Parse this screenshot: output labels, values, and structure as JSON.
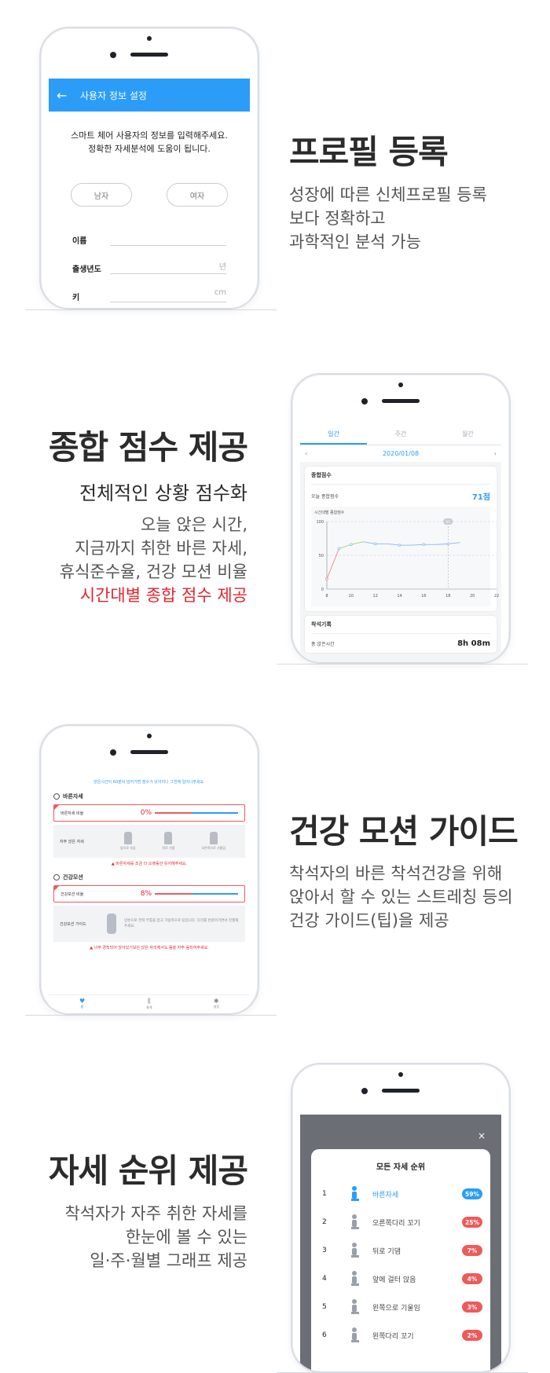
{
  "colors": {
    "accent": "#2b9df8",
    "red": "#e4252e",
    "badge_red": "#ee5a5a"
  },
  "section1": {
    "heading": "프로필 등록",
    "desc": [
      "성장에 따른 신체프로필 등록",
      "보다 정확하고",
      "과학적인 분석 가능"
    ],
    "screen": {
      "back_icon": "←",
      "title": "사용자 정보 설정",
      "intro": [
        "스마트 체어 사용자의 정보를 입력해주세요.",
        "정확한 자세분석에 도움이 됩니다."
      ],
      "gender_male": "남자",
      "gender_female": "여자",
      "fields": [
        {
          "label": "이름",
          "unit": ""
        },
        {
          "label": "출생년도",
          "unit": "년"
        },
        {
          "label": "키",
          "unit": "cm"
        }
      ]
    }
  },
  "section2": {
    "heading": "종합 점수 제공",
    "subhead": "전체적인 상황 점수화",
    "desc": [
      "오늘 앉은 시간,",
      "지금까지 취한 바른 자세,",
      "휴식준수율, 건강 모션 비율"
    ],
    "desc_highlight": "시간대별 종합 점수 제공",
    "screen": {
      "tabs": [
        "일간",
        "주간",
        "월간"
      ],
      "date": "2020/01/08",
      "prev": "‹",
      "next": "›",
      "card_title": "종합점수",
      "today_label": "오늘 종합점수",
      "today_score": "71점",
      "chart_title": "시간대별 종합점수",
      "card2_title": "착석기록",
      "sit_label": "총 앉은시간",
      "sit_value": "8h 08m"
    }
  },
  "section3": {
    "heading": "건강 모션 가이드",
    "desc": [
      "착석자의 바른 착석건강을 위해",
      "앉아서 할 수 있는 스트레칭 등의",
      "건강 가이드(팁)을 제공"
    ],
    "screen": {
      "hint": "앉은시간이 60분이 넘어가면 점수가 낮아지니 그전에 일어나주세요.",
      "sec1": "바른자세",
      "ratio1_label": "바른자세 비율",
      "ratio1_value": "0%",
      "freq_label": "자주 앉은 자세",
      "figs": [
        "앞으로 숙임",
        "뒤로 기댐",
        "오른쪽으로 기울임"
      ],
      "warn1": "바른자세를 조금 더 오랫동안 유지해주세요.",
      "sec2": "건강모션",
      "ratio2_label": "건강모션 비율",
      "ratio2_value": "8%",
      "guide_label": "건강모션 가이드",
      "guide_text": "양손으로 전력 무릎을 잡고 가슴쪽으로 당깁니다. 다리를 번갈아가면서 진행해주세요.",
      "warn2": "너무 경직되어 앉아있기보단 앉은 자리에서도 몸을 자주 움직여주세요.",
      "nav": [
        {
          "icon": "♥",
          "label": "홈"
        },
        {
          "icon": "⫼",
          "label": "통계"
        },
        {
          "icon": "✱",
          "label": "설정"
        }
      ]
    }
  },
  "section4": {
    "heading": "자세 순위 제공",
    "desc": [
      "착석자가 자주 취한 자세를",
      "한눈에 볼 수 있는",
      "일·주·월별 그래프 제공"
    ],
    "screen": {
      "close": "×",
      "title": "모든 자세 순위",
      "ranks": [
        {
          "n": "1",
          "label": "바른자세",
          "pct": "59%",
          "color": "#2b9df8",
          "label_color": "#2b9df8"
        },
        {
          "n": "2",
          "label": "오른쪽다리 꼬기",
          "pct": "25%",
          "color": "#ee5a5a",
          "label_color": "#444444"
        },
        {
          "n": "3",
          "label": "뒤로 기댐",
          "pct": "7%",
          "color": "#ee5a5a",
          "label_color": "#444444"
        },
        {
          "n": "4",
          "label": "앞에 걸터 앉음",
          "pct": "4%",
          "color": "#ee5a5a",
          "label_color": "#444444"
        },
        {
          "n": "5",
          "label": "왼쪽으로 기울임",
          "pct": "3%",
          "color": "#ee5a5a",
          "label_color": "#444444"
        },
        {
          "n": "6",
          "label": "왼쪽다리 꼬기",
          "pct": "2%",
          "color": "#ee5a5a",
          "label_color": "#444444"
        }
      ]
    }
  },
  "chart_data": {
    "type": "line",
    "title": "시간대별 종합점수",
    "x": [
      8,
      9,
      10,
      11,
      12,
      13,
      14,
      15,
      16,
      17,
      18,
      19
    ],
    "values": [
      15,
      60,
      66,
      70,
      67,
      67,
      65,
      65,
      66,
      66,
      67,
      69
    ],
    "xticks": [
      "8",
      "10",
      "12",
      "14",
      "16",
      "18",
      "20",
      "22"
    ],
    "yticks": [
      "0",
      "50",
      "100"
    ],
    "xlim": [
      8,
      22
    ],
    "ylim": [
      0,
      100
    ],
    "marker_x": 18,
    "marker_label": "65",
    "grid": "dashed"
  }
}
